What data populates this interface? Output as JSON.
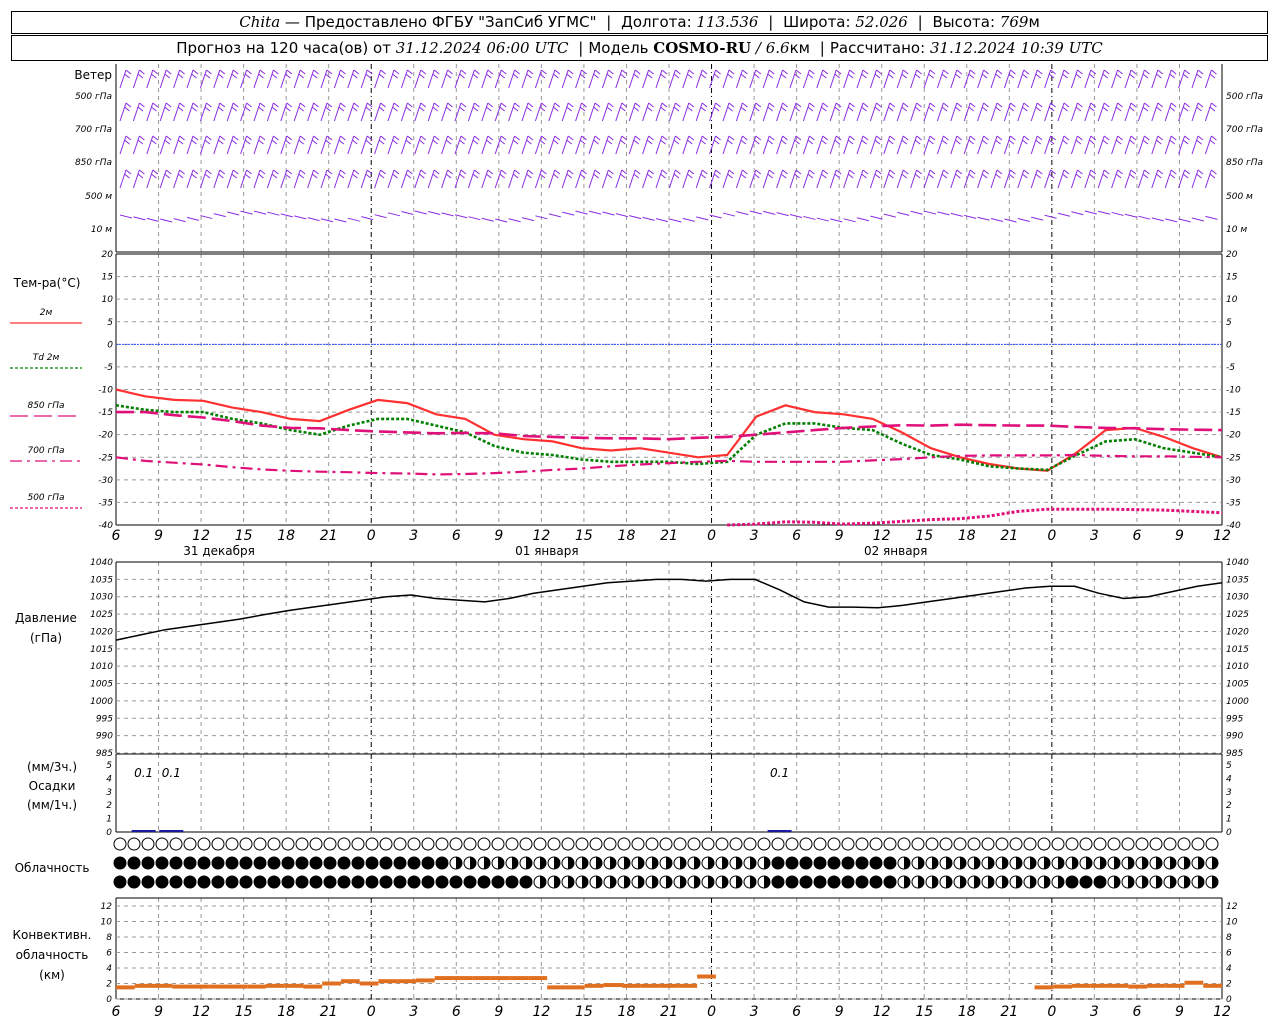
{
  "header": {
    "station": "Chita",
    "provider": "— Предоставлено ФГБУ \"ЗапСиб УГМС\"",
    "lon_label": "Долгота:",
    "lon": "113.536",
    "lat_label": "Широта:",
    "lat": "52.026",
    "alt_label": "Высота:",
    "alt": "769",
    "alt_unit": "м",
    "forecast_label": "Прогноз на 120 часа(ов) от",
    "forecast_start": "31.12.2024 06:00 UTC",
    "model_label": "Модель",
    "model": "COSMO-RU",
    "resolution": "6.6",
    "res_unit": "км",
    "calc_label": "Рассчитано:",
    "calc_time": "31.12.2024 10:39 UTC"
  },
  "wind_panel": {
    "title": "Ветер",
    "levels": [
      "500 гПа",
      "700 гПа",
      "850 гПа",
      "500 м",
      "10 м"
    ]
  },
  "temp_panel": {
    "title": "Тем-ра(°C)",
    "legend": [
      {
        "label": "2м",
        "color": "#ff3030",
        "dash": "solid"
      },
      {
        "label": "Td 2м",
        "color": "#008000",
        "dash": "dotted"
      },
      {
        "label": "850 гПа",
        "color": "#e0107a",
        "dash": "long-dash"
      },
      {
        "label": "700 гПа",
        "color": "#e0107a",
        "dash": "dash-dot"
      },
      {
        "label": "500 гПа",
        "color": "#e0107a",
        "dash": "dotted"
      }
    ],
    "yticks": [
      "20",
      "15",
      "10",
      "5",
      "0",
      "-5",
      "-10",
      "-15",
      "-20",
      "-25",
      "-30",
      "-35",
      "-40"
    ]
  },
  "time_axis": {
    "ticks": [
      "6",
      "9",
      "12",
      "15",
      "18",
      "21",
      "0",
      "3",
      "6",
      "9",
      "12",
      "15",
      "18",
      "21",
      "0",
      "3",
      "6",
      "9",
      "12",
      "15",
      "18",
      "21",
      "0",
      "3",
      "6",
      "9",
      "12"
    ],
    "dates": [
      "31 декабря",
      "01 января",
      "02 января"
    ]
  },
  "pressure_panel": {
    "title": "Давление",
    "unit": "(гПа)",
    "yticks": [
      "1040",
      "1035",
      "1030",
      "1025",
      "1020",
      "1015",
      "1010",
      "1005",
      "1000",
      "995",
      "990",
      "985"
    ]
  },
  "precip_panel": {
    "unit3": "(мм/3ч.)",
    "title": "Осадки",
    "unit1": "(мм/1ч.)",
    "yticks": [
      "5",
      "4",
      "3",
      "2",
      "1",
      "0"
    ],
    "annotations": [
      "0.1",
      "0.1",
      "0.1"
    ]
  },
  "cloud_panel": {
    "title": "Облачность"
  },
  "conv_panel": {
    "title1": "Конвективн.",
    "title2": "облачность",
    "unit": "(км)",
    "yticks": [
      "12",
      "10",
      "8",
      "6",
      "4",
      "2",
      "0"
    ]
  },
  "chart_data": {
    "type": "line",
    "x_hours": [
      0,
      3,
      6,
      9,
      12,
      15,
      18,
      21,
      24,
      27,
      30,
      33,
      36,
      39,
      42,
      45,
      48,
      51,
      54,
      57,
      60,
      63,
      66,
      69,
      72,
      75,
      78
    ],
    "x_labels": [
      "6",
      "9",
      "12",
      "15",
      "18",
      "21",
      "0",
      "3",
      "6",
      "9",
      "12",
      "15",
      "18",
      "21",
      "0",
      "3",
      "6",
      "9",
      "12",
      "15",
      "18",
      "21",
      "0",
      "3",
      "6",
      "9",
      "12"
    ],
    "temperature": {
      "ylim": [
        -40,
        20
      ],
      "series": [
        {
          "name": "2м",
          "values": [
            -10,
            -11.5,
            -12.3,
            -12.5,
            -14,
            -15,
            -16.5,
            -17,
            -14.5,
            -12.3,
            -13,
            -15.5,
            -16.5,
            -20,
            -21,
            -21.5,
            -23,
            -23.5,
            -23,
            -24,
            -25,
            -24.5,
            -16,
            -13.5,
            -15,
            -15.5,
            -16.5,
            -19.5,
            -23,
            -25,
            -26.5,
            -27.5,
            -28,
            -24,
            -19,
            -18.5,
            -20.5,
            -23,
            -25
          ]
        },
        {
          "name": "Td 2м",
          "values": [
            -13.5,
            -14.5,
            -15,
            -15,
            -16.5,
            -17.5,
            -19,
            -20,
            -18,
            -16.5,
            -16.5,
            -18,
            -19.5,
            -22.5,
            -24,
            -24.5,
            -25.5,
            -26,
            -26,
            -26,
            -26.5,
            -26,
            -20,
            -17.5,
            -17.5,
            -18.5,
            -19,
            -22,
            -24.5,
            -25.5,
            -27,
            -27.5,
            -27.8,
            -24.5,
            -21.5,
            -21,
            -23,
            -24,
            -25
          ]
        },
        {
          "name": "850 гПа",
          "values": [
            -15,
            -15,
            -15.7,
            -16.2,
            -17,
            -18,
            -18.5,
            -18.6,
            -19,
            -19.3,
            -19.5,
            -19.7,
            -19.6,
            -19.7,
            -20.3,
            -20.5,
            -20.7,
            -20.8,
            -20.8,
            -21,
            -20.7,
            -20.5,
            -20,
            -19.5,
            -19,
            -18.5,
            -18.2,
            -17.9,
            -18,
            -17.8,
            -17.9,
            -18,
            -18,
            -18.3,
            -18.5,
            -18.6,
            -18.8,
            -18.9,
            -19
          ]
        },
        {
          "name": "700 гПа",
          "values": [
            -25,
            -25.8,
            -26.2,
            -26.6,
            -27.2,
            -27.7,
            -28,
            -28.2,
            -28.3,
            -28.5,
            -28.6,
            -28.8,
            -28.7,
            -28.5,
            -28.2,
            -27.8,
            -27.5,
            -27,
            -26.6,
            -26.3,
            -26,
            -25.8,
            -26,
            -26,
            -26,
            -26,
            -25.7,
            -25.4,
            -25,
            -24.7,
            -24.6,
            -24.6,
            -24.6,
            -24.5,
            -24.7,
            -24.8,
            -24.8,
            -24.9,
            -25
          ]
        },
        {
          "name": "500 гПа",
          "values": [
            null,
            null,
            null,
            null,
            null,
            null,
            null,
            null,
            null,
            null,
            null,
            null,
            null,
            null,
            null,
            null,
            null,
            null,
            null,
            null,
            null,
            -40,
            -39.8,
            -39.3,
            -39.4,
            -39.8,
            -39.6,
            -39.2,
            -38.8,
            -38.6,
            -38,
            -37,
            -36.5,
            -36.5,
            -36.5,
            -36.6,
            -36.7,
            -37,
            -37.3
          ]
        }
      ]
    },
    "pressure": {
      "ylim": [
        985,
        1040
      ],
      "series": [
        {
          "name": "Давление",
          "values": [
            1017.5,
            1019,
            1020.5,
            1021.5,
            1022.5,
            1023.5,
            1024.8,
            1026,
            1027,
            1028,
            1029,
            1030,
            1030.5,
            1029.5,
            1029,
            1028.5,
            1029.5,
            1031,
            1032,
            1033,
            1034,
            1034.5,
            1035,
            1035,
            1034.5,
            1035,
            1035,
            1032,
            1028.5,
            1027,
            1027,
            1026.8,
            1027.5,
            1028.5,
            1029.5,
            1030.5,
            1031.5,
            1032.5,
            1033,
            1033,
            1031,
            1029.5,
            1030,
            1031.5,
            1033,
            1034
          ]
        }
      ]
    },
    "precip_mm_3h": [
      0,
      0.1,
      0.1,
      0,
      0,
      0,
      0,
      0,
      0,
      0,
      0,
      0,
      0,
      0,
      0,
      0,
      0,
      0,
      0,
      0,
      0,
      0,
      0,
      0,
      0.1,
      0,
      0,
      0,
      0,
      0,
      0,
      0,
      0,
      0,
      0,
      0,
      0,
      0,
      0,
      0,
      0
    ],
    "convective_cloud_top_km": [
      1.5,
      1.7,
      1.7,
      1.6,
      1.6,
      1.6,
      1.6,
      1.6,
      1.7,
      1.7,
      1.6,
      2.0,
      2.3,
      2.0,
      2.3,
      2.3,
      2.4,
      2.7,
      2.7,
      2.7,
      2.7,
      2.7,
      2.7,
      1.5,
      1.5,
      1.7,
      1.8,
      1.7,
      1.7,
      1.7,
      1.7,
      2.9,
      null,
      null,
      null,
      null,
      null,
      null,
      null,
      null,
      null,
      null,
      null,
      null,
      null,
      null,
      null,
      null,
      null,
      1.5,
      1.6,
      1.7,
      1.7,
      1.7,
      1.6,
      1.7,
      1.7,
      2.1,
      1.7,
      null
    ]
  }
}
